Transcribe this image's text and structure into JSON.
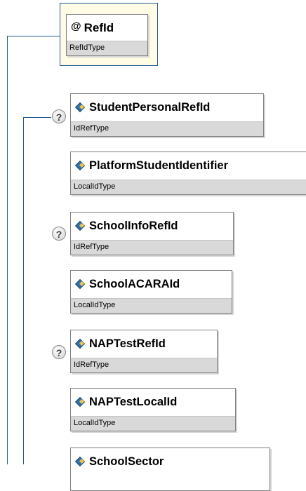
{
  "attribute": {
    "name": "RefId",
    "type": "RefIdType",
    "icon": "at-sign-icon"
  },
  "elements": [
    {
      "name": "StudentPersonalRefId",
      "type": "IdRefType",
      "optional": true
    },
    {
      "name": "PlatformStudentIdentifier",
      "type": "LocalIdType",
      "optional": false
    },
    {
      "name": "SchoolInfoRefId",
      "type": "IdRefType",
      "optional": true
    },
    {
      "name": "SchoolACARAId",
      "type": "LocalIdType",
      "optional": false
    },
    {
      "name": "NAPTestRefId",
      "type": "IdRefType",
      "optional": true
    },
    {
      "name": "NAPTestLocalId",
      "type": "LocalIdType",
      "optional": false
    },
    {
      "name": "SchoolSector",
      "type": "",
      "optional": false
    }
  ],
  "colors": {
    "connector": "#1f5b94",
    "attribute_bg": "#fffbe5",
    "type_band": "#d9d9d9"
  }
}
